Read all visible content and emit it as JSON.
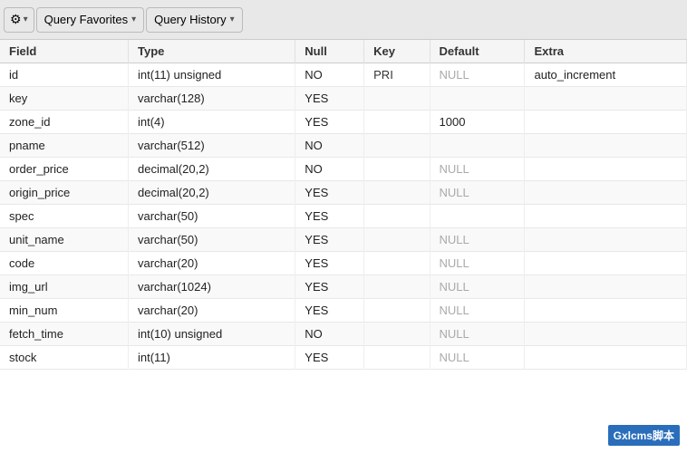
{
  "toolbar": {
    "gear_icon": "⚙",
    "dropdown_arrow": "▾",
    "favorites_label": "Query Favorites",
    "history_label": "Query History"
  },
  "table": {
    "headers": [
      "Field",
      "Type",
      "Null",
      "Key",
      "Default",
      "Extra"
    ],
    "rows": [
      {
        "field": "id",
        "type": "int(11) unsigned",
        "null": "NO",
        "key": "PRI",
        "default": "NULL",
        "extra": "auto_increment",
        "default_null": true
      },
      {
        "field": "key",
        "type": "varchar(128)",
        "null": "YES",
        "key": "",
        "default": "",
        "extra": "",
        "default_null": false
      },
      {
        "field": "zone_id",
        "type": "int(4)",
        "null": "YES",
        "key": "",
        "default": "1000",
        "extra": "",
        "default_null": false
      },
      {
        "field": "pname",
        "type": "varchar(512)",
        "null": "NO",
        "key": "",
        "default": "",
        "extra": "",
        "default_null": false
      },
      {
        "field": "order_price",
        "type": "decimal(20,2)",
        "null": "NO",
        "key": "",
        "default": "NULL",
        "extra": "",
        "default_null": true
      },
      {
        "field": "origin_price",
        "type": "decimal(20,2)",
        "null": "YES",
        "key": "",
        "default": "NULL",
        "extra": "",
        "default_null": true
      },
      {
        "field": "spec",
        "type": "varchar(50)",
        "null": "YES",
        "key": "",
        "default": "",
        "extra": "",
        "default_null": false
      },
      {
        "field": "unit_name",
        "type": "varchar(50)",
        "null": "YES",
        "key": "",
        "default": "NULL",
        "extra": "",
        "default_null": true
      },
      {
        "field": "code",
        "type": "varchar(20)",
        "null": "YES",
        "key": "",
        "default": "NULL",
        "extra": "",
        "default_null": true
      },
      {
        "field": "img_url",
        "type": "varchar(1024)",
        "null": "YES",
        "key": "",
        "default": "NULL",
        "extra": "",
        "default_null": true
      },
      {
        "field": "min_num",
        "type": "varchar(20)",
        "null": "YES",
        "key": "",
        "default": "NULL",
        "extra": "",
        "default_null": true
      },
      {
        "field": "fetch_time",
        "type": "int(10) unsigned",
        "null": "NO",
        "key": "",
        "default": "NULL",
        "extra": "",
        "default_null": true
      },
      {
        "field": "stock",
        "type": "int(11)",
        "null": "YES",
        "key": "",
        "default": "NULL",
        "extra": "",
        "default_null": true
      }
    ]
  },
  "watermark": {
    "text": "Gxlcms脚本"
  }
}
